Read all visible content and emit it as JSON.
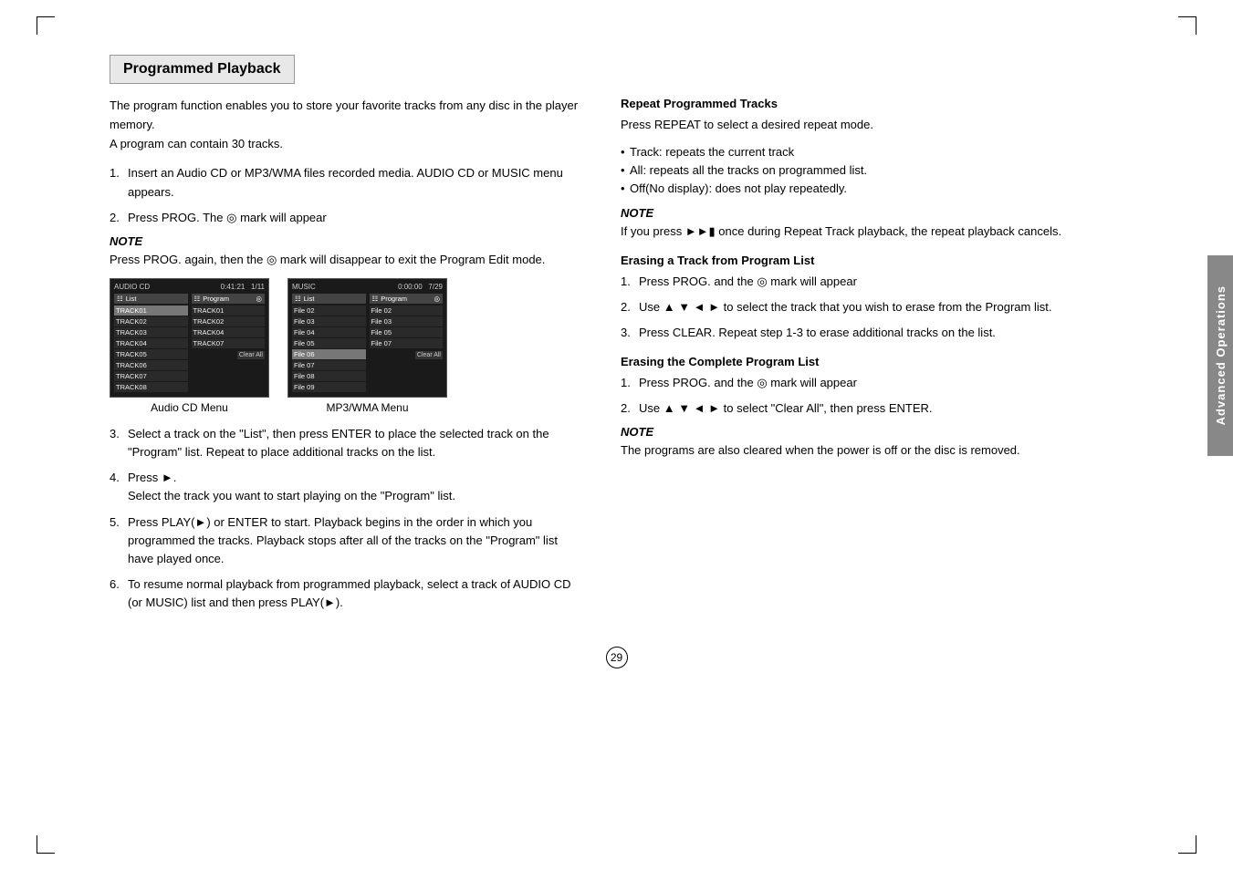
{
  "page": {
    "number": "29",
    "side_tab": "Advanced Operations"
  },
  "section": {
    "title": "Programmed Playback",
    "intro": [
      "The program function enables you to store your favorite tracks from any disc in the player memory.",
      "A program can contain 30 tracks."
    ],
    "steps": [
      {
        "num": "1.",
        "text": "Insert an Audio CD or MP3/WMA files recorded media. AUDIO CD or MUSIC menu appears."
      },
      {
        "num": "2.",
        "text": "Press PROG. The  ◎  mark will appear"
      },
      {
        "num": "3.",
        "text": "Select a track on the \"List\", then press ENTER to place the selected track on the \"Program\" list. Repeat to place additional tracks on the list."
      },
      {
        "num": "4.",
        "text": "Press ►.\nSelect the track you want to start playing on the \"Program\" list."
      },
      {
        "num": "5.",
        "text": "Press PLAY(►) or ENTER to start. Playback begins in the order in which you programmed the tracks. Playback stops after all of the tracks on the \"Program\" list have played once."
      },
      {
        "num": "6.",
        "text": "To resume normal playback from programmed playback, select a track of AUDIO CD (or MUSIC) list and then press PLAY(►)."
      }
    ],
    "note_label": "NOTE",
    "note_text": "Press PROG. again, then the  ◎  mark will disappear to exit the Program Edit mode.",
    "screen_audio_label": "Audio CD Menu",
    "screen_mp3_label": "MP3/WMA Menu",
    "audio_cd_screen": {
      "title": "AUDIO CD",
      "time": "0:41:21",
      "track_count": "1/11",
      "list_col": "List",
      "prog_col": "Program",
      "tracks_list": [
        "TRACK01",
        "TRACK02",
        "TRACK03",
        "TRACK04",
        "TRACK05",
        "TRACK06",
        "TRACK07",
        "TRACK08"
      ],
      "tracks_prog": [
        "TRACK01",
        "TRACK02",
        "TRACK04",
        "TRACK07"
      ],
      "clear_all": "Clear All"
    },
    "mp3_screen": {
      "title": "MUSIC",
      "time": "0:00:00",
      "track_count": "7/29",
      "list_col": "List",
      "prog_col": "Program",
      "files_list": [
        "File 02",
        "File 03",
        "File 04",
        "File 05",
        "File 06",
        "File 07",
        "File 08",
        "File 09"
      ],
      "files_prog": [
        "File 02",
        "File 03",
        "File 05",
        "File 07"
      ],
      "clear_all": "Clear All"
    }
  },
  "right_section": {
    "repeat_title": "Repeat Programmed Tracks",
    "repeat_intro": "Press REPEAT to select a desired repeat mode.",
    "repeat_bullets": [
      "Track: repeats the current track",
      "All: repeats all the tracks on programmed list.",
      "Off(No display): does not play repeatedly."
    ],
    "repeat_note_label": "NOTE",
    "repeat_note_text": "If you press ►►□ once during Repeat Track playback, the repeat playback cancels.",
    "erase_track_title": "Erasing a Track from Program List",
    "erase_track_steps": [
      {
        "num": "1.",
        "text": "Press PROG. and the  ◎  mark will appear"
      },
      {
        "num": "2.",
        "text": "Use ▲ ▼ ◄ ► to select the track that you wish to erase from the Program list."
      },
      {
        "num": "3.",
        "text": "Press CLEAR. Repeat step 1-3 to erase additional tracks on the list."
      }
    ],
    "erase_complete_title": "Erasing the Complete Program List",
    "erase_complete_steps": [
      {
        "num": "1.",
        "text": "Press PROG. and the  ◎  mark will appear"
      },
      {
        "num": "2.",
        "text": "Use ▲ ▼ ◄ ► to select \"Clear All\", then press ENTER."
      }
    ],
    "bottom_note_label": "NOTE",
    "bottom_note_text": "The programs are also cleared when the power is off or the disc is removed."
  }
}
